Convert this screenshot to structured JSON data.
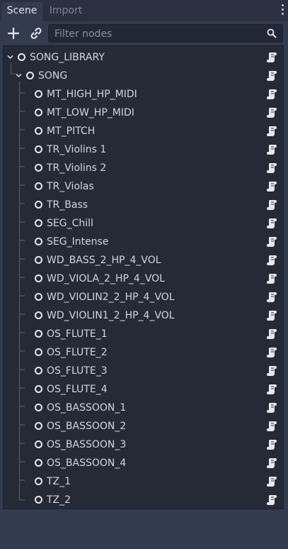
{
  "tabs": [
    {
      "label": "Scene",
      "active": true
    },
    {
      "label": "Import",
      "active": false
    }
  ],
  "toolbar": {
    "add_icon": "plus-icon",
    "link_icon": "link-icon",
    "filter_placeholder": "Filter nodes",
    "filter_value": "",
    "search_icon": "search-icon"
  },
  "tree": {
    "root": {
      "label": "SONG_LIBRARY",
      "expanded": true
    },
    "song": {
      "label": "SONG",
      "expanded": true
    },
    "children": [
      "MT_HIGH_HP_MIDI",
      "MT_LOW_HP_MIDI",
      "MT_PITCH",
      "TR_Violins 1",
      "TR_Violins 2",
      "TR_Violas",
      "TR_Bass",
      "SEG_Chill",
      "SEG_Intense",
      "WD_BASS_2_HP_4_VOL",
      "WD_VIOLA_2_HP_4_VOL",
      "WD_VIOLIN2_2_HP_4_VOL",
      "WD_VIOLIN1_2_HP_4_VOL",
      "OS_FLUTE_1",
      "OS_FLUTE_2",
      "OS_FLUTE_3",
      "OS_FLUTE_4",
      "OS_BASSOON_1",
      "OS_BASSOON_2",
      "OS_BASSOON_3",
      "OS_BASSOON_4",
      "TZ_1",
      "TZ_2"
    ],
    "node_icon": "node-circle-icon",
    "script_icon": "script-icon"
  },
  "colors": {
    "panel_bg": "#333b4f",
    "tree_bg": "#252a37",
    "text": "#d3d6dc",
    "icon": "#e6e8ec"
  }
}
